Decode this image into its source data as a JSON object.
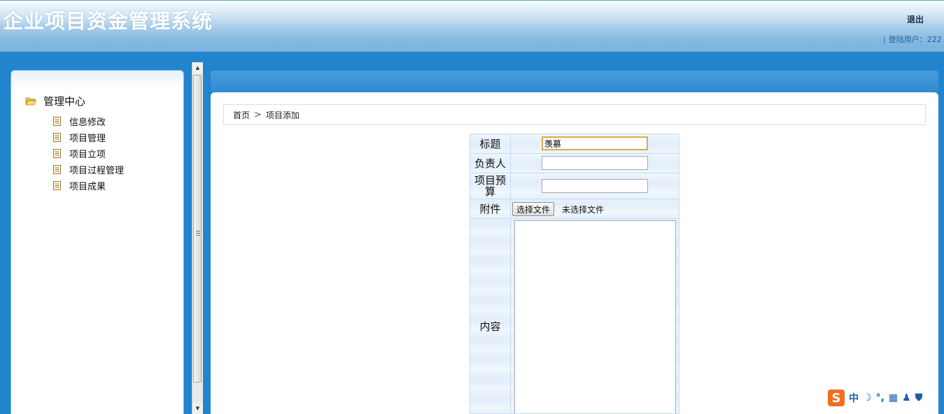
{
  "header": {
    "title": "企业项目资金管理系统",
    "logout_label": "退出",
    "login_label": "登陆用户：222"
  },
  "sidebar": {
    "root_label": "管理中心",
    "items": [
      {
        "label": "信息修改"
      },
      {
        "label": "项目管理"
      },
      {
        "label": "项目立项"
      },
      {
        "label": "项目过程管理"
      },
      {
        "label": "项目成果"
      }
    ]
  },
  "breadcrumb": {
    "home": "首页",
    "current": "项目添加"
  },
  "form": {
    "title_label": "标题",
    "title_value": "羡慕",
    "owner_label": "负责人",
    "owner_value": "",
    "budget_label": "项目预算",
    "budget_value": "",
    "attachment_label": "附件",
    "choose_file_button": "选择文件",
    "file_status": "未选择文件",
    "content_label": "内容"
  },
  "ime_toolbar": {
    "logo": "S",
    "mode": "中"
  },
  "colors": {
    "header_band": "#2184cd",
    "accent_focus": "#e0a74a"
  }
}
